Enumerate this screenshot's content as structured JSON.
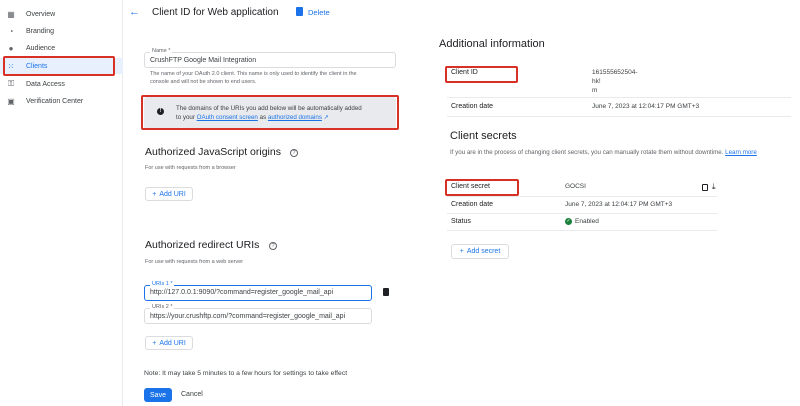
{
  "sidebar": {
    "items": [
      {
        "label": "Overview",
        "icon": "grid-icon"
      },
      {
        "label": "Branding",
        "icon": "palette-icon"
      },
      {
        "label": "Audience",
        "icon": "person-icon"
      },
      {
        "label": "Clients",
        "icon": "apps-icon"
      },
      {
        "label": "Data Access",
        "icon": "key-icon"
      },
      {
        "label": "Verification Center",
        "icon": "calendar-check-icon"
      }
    ],
    "active": "Clients"
  },
  "header": {
    "title": "Client ID for Web application",
    "delete_label": "Delete"
  },
  "name_field": {
    "label": "Name *",
    "value": "CrushFTP Google Mail Integration",
    "helper_line1": "The name of your OAuth 2.0 client. This name is only used to identify the client in the",
    "helper_line2": "console and will not be shown to end users."
  },
  "banner": {
    "text_part1": "The domains of the URIs you add below will be automatically added",
    "text_part2": "to your",
    "link1": "OAuth consent screen",
    "text_part3": "as",
    "link2": "authorized domains"
  },
  "js_origins": {
    "title": "Authorized JavaScript origins",
    "helper": "For use with requests from a browser",
    "add_label": "Add URI"
  },
  "redirect_uris": {
    "title": "Authorized redirect URIs",
    "helper": "For use with requests from a web server",
    "uri1_label": "URIs 1 *",
    "uri1_value": "http://127.0.0.1:9090/?command=register_google_mail_api",
    "uri2_label": "URIs 2 *",
    "uri2_value": "https://your.crushftp.com/?command=register_google_mail_api",
    "add_label": "Add URI"
  },
  "note": "Note: It may take 5 minutes to a few hours for settings to take effect",
  "footer": {
    "save_label": "Save",
    "cancel_label": "Cancel"
  },
  "additional_info": {
    "title": "Additional information",
    "client_id_key": "Client ID",
    "client_id_val_line1": "161555652504-",
    "client_id_val_line2": "hk!",
    "client_id_val_line3": "m",
    "creation_key": "Creation date",
    "creation_val": "June 7, 2023 at 12:04:17 PM GMT+3"
  },
  "client_secrets": {
    "title": "Client secrets",
    "desc": "If you are in the process of changing client secrets, you can manually rotate them without downtime.",
    "learn_more": "Learn more",
    "secret_key": "Client secret",
    "secret_val": "GOCSI",
    "creation_key": "Creation date",
    "creation_val": "June 7, 2023 at 12:04:17 PM GMT+3",
    "status_key": "Status",
    "status_val": "Enabled",
    "add_secret_label": "Add secret"
  },
  "colors": {
    "accent": "#1a73e8",
    "highlight": "#d93025",
    "enabled": "#188038"
  }
}
